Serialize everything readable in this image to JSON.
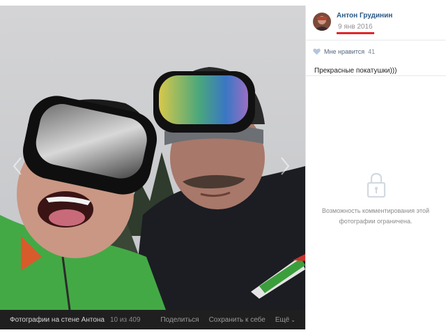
{
  "author": {
    "name": "Антон Грудинин",
    "date": "9 янв 2016"
  },
  "likes": {
    "label": "Мне нравится",
    "count": "41"
  },
  "caption": "Прекрасные покатушки)))",
  "comments": {
    "restricted_text": "Возможность комментирования этой фотографии ограничена."
  },
  "footer": {
    "album_title": "Фотографии на стене Антона",
    "counter": "10 из 409",
    "share_label": "Поделиться",
    "save_label": "Сохранить к себе",
    "more_label": "Ещё"
  },
  "colors": {
    "link_blue": "#2a5885",
    "highlight_underline": "#e0262b",
    "footer_bg": "#1f1f1f"
  },
  "icons": {
    "heart": "heart-icon",
    "lock": "lock-icon",
    "prev": "chevron-left-icon",
    "next": "chevron-right-icon",
    "more": "chevron-down-icon"
  }
}
